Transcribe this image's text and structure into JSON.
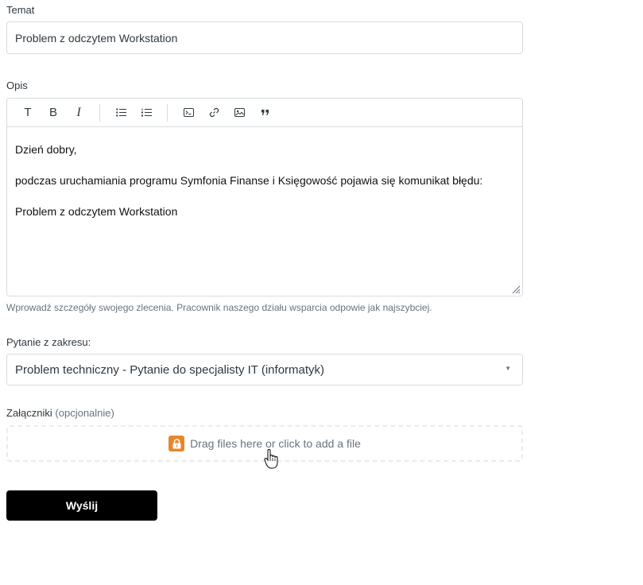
{
  "subject": {
    "label": "Temat",
    "value": "Problem z odczytem Workstation"
  },
  "description": {
    "label": "Opis",
    "toolbar": {
      "text_glyph": "T",
      "bold_glyph": "B",
      "italic_glyph": "I"
    },
    "paragraphs": [
      "Dzień dobry,",
      "podczas uruchamiania programu Symfonia Finanse i Księgowość pojawia się komunikat błędu:",
      "Problem z odczytem Workstation"
    ],
    "hint": "Wprowadź szczegóły swojego zlecenia. Pracownik naszego działu wsparcia odpowie jak najszybciej."
  },
  "question_scope": {
    "label": "Pytanie z zakresu:",
    "selected": "Problem techniczny - Pytanie do specjalisty IT (informatyk)"
  },
  "attachments": {
    "label": "Załączniki",
    "optional": "(opcjonalnie)",
    "dropzone_text": "Drag files here or click to add a file",
    "icon": "lock-icon",
    "icon_color": "#e8862a"
  },
  "submit": {
    "label": "Wyślij"
  }
}
